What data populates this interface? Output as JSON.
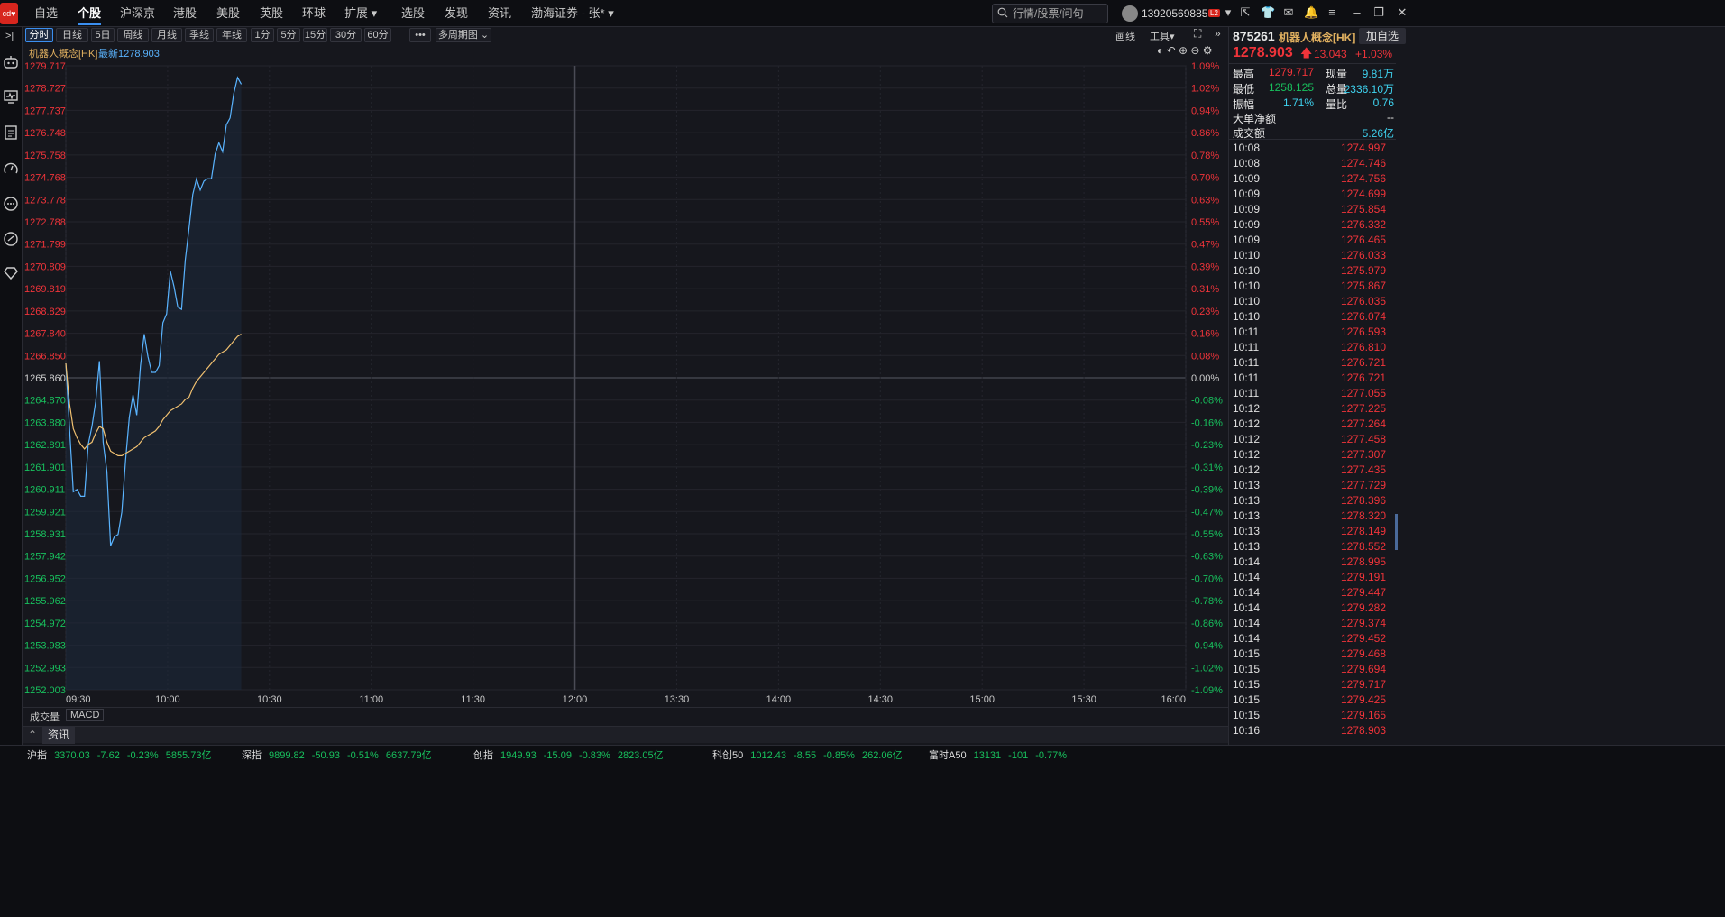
{
  "topnav": {
    "items": [
      "自选",
      "个股",
      "沪深京",
      "港股",
      "美股",
      "英股",
      "环球",
      "扩展 ▾",
      "选股",
      "发现",
      "资讯",
      "渤海证券 - 张* ▾"
    ],
    "active": 1,
    "logo": "cd♥",
    "search_placeholder": "行情/股票/问句",
    "user": "13920569885",
    "level_badge": "L2"
  },
  "left_icons": [
    "collapse-icon",
    "robot-icon",
    "monitor-icon",
    "notes-icon",
    "gauge-icon",
    "chat-icon",
    "link-icon",
    "diamond-icon"
  ],
  "toolbar": {
    "periods": [
      "分时",
      "日线",
      "5日",
      "周线",
      "月线",
      "季线",
      "年线",
      "1分",
      "5分",
      "15分",
      "30分",
      "60分",
      "•••",
      "多周期图 ⌄"
    ],
    "active": 0,
    "draw": "画线",
    "tools": "工具▾"
  },
  "chart_header": {
    "name": "机器人概念[HK]",
    "latest_label": "最新1278.903"
  },
  "chart_data": {
    "type": "line",
    "title": "机器人概念[HK]",
    "prev_close": 1265.86,
    "y_ticks": [
      "1279.717",
      "1278.727",
      "1277.737",
      "1276.748",
      "1275.758",
      "1274.768",
      "1273.778",
      "1272.788",
      "1271.799",
      "1270.809",
      "1269.819",
      "1268.829",
      "1267.840",
      "1266.850",
      "1265.860",
      "1264.870",
      "1263.880",
      "1262.891",
      "1261.901",
      "1260.911",
      "1259.921",
      "1258.931",
      "1257.942",
      "1256.952",
      "1255.962",
      "1254.972",
      "1253.983",
      "1252.993",
      "1252.003"
    ],
    "pct_ticks": [
      "1.09%",
      "1.02%",
      "0.94%",
      "0.86%",
      "0.78%",
      "0.70%",
      "0.63%",
      "0.55%",
      "0.47%",
      "0.39%",
      "0.31%",
      "0.23%",
      "0.16%",
      "0.08%",
      "0.00%",
      "-0.08%",
      "-0.16%",
      "-0.23%",
      "-0.31%",
      "-0.39%",
      "-0.47%",
      "-0.55%",
      "-0.63%",
      "-0.70%",
      "-0.78%",
      "-0.86%",
      "-0.94%",
      "-1.02%",
      "-1.09%"
    ],
    "x_ticks": [
      "09:30",
      "10:00",
      "10:30",
      "11:00",
      "11:30",
      "12:00",
      "13:30",
      "14:00",
      "14:30",
      "15:00",
      "15:30",
      "16:00"
    ],
    "ylim": [
      1252.003,
      1279.717
    ],
    "price": [
      1266.5,
      1263.6,
      1260.8,
      1260.9,
      1260.6,
      1260.6,
      1262.9,
      1263.7,
      1264.8,
      1266.6,
      1263.0,
      1261.7,
      1258.4,
      1258.8,
      1258.9,
      1259.9,
      1262.2,
      1264.1,
      1265.1,
      1264.2,
      1266.4,
      1267.8,
      1266.8,
      1266.1,
      1266.1,
      1266.4,
      1268.3,
      1268.7,
      1270.6,
      1269.9,
      1269.0,
      1268.9,
      1271.1,
      1272.5,
      1274.0,
      1274.7,
      1274.2,
      1274.6,
      1274.7,
      1274.7,
      1275.8,
      1276.3,
      1275.9,
      1277.1,
      1277.4,
      1278.5,
      1279.2,
      1278.9
    ],
    "avg": [
      1266.5,
      1264.7,
      1263.6,
      1263.2,
      1262.9,
      1262.7,
      1262.9,
      1263.0,
      1263.4,
      1263.7,
      1263.6,
      1263.0,
      1262.6,
      1262.5,
      1262.4,
      1262.4,
      1262.5,
      1262.6,
      1262.7,
      1262.8,
      1263.0,
      1263.2,
      1263.3,
      1263.4,
      1263.5,
      1263.7,
      1264.0,
      1264.2,
      1264.4,
      1264.5,
      1264.6,
      1264.7,
      1264.9,
      1265.0,
      1265.4,
      1265.7,
      1265.9,
      1266.1,
      1266.3,
      1266.5,
      1266.7,
      1266.9,
      1267.0,
      1267.1,
      1267.3,
      1267.5,
      1267.7,
      1267.8
    ]
  },
  "bottom_tabs": [
    "成交量",
    "MACD"
  ],
  "news_tab": "资讯",
  "quote": {
    "code": "875261",
    "name": "机器人概念[HK]",
    "add": "加自选",
    "price": "1278.903",
    "change": "13.043",
    "pct": "+1.03%",
    "stats": [
      {
        "l1": "最高",
        "v1": "1279.717",
        "c1": "red",
        "l2": "现量",
        "v2": "9.81万",
        "c2": "cyan"
      },
      {
        "l1": "最低",
        "v1": "1258.125",
        "c1": "green",
        "l2": "总量",
        "v2": "2336.10万",
        "c2": "cyan"
      },
      {
        "l1": "振幅",
        "v1": "1.71%",
        "c1": "cyan",
        "l2": "量比",
        "v2": "0.76",
        "c2": "cyan"
      }
    ],
    "big_order_label": "大单净额",
    "big_order": "--",
    "turnover_label": "成交额",
    "turnover": "5.26亿"
  },
  "ticks": [
    [
      "10:08",
      "1274.997"
    ],
    [
      "10:08",
      "1274.746"
    ],
    [
      "10:09",
      "1274.756"
    ],
    [
      "10:09",
      "1274.699"
    ],
    [
      "10:09",
      "1275.854"
    ],
    [
      "10:09",
      "1276.332"
    ],
    [
      "10:09",
      "1276.465"
    ],
    [
      "10:10",
      "1276.033"
    ],
    [
      "10:10",
      "1275.979"
    ],
    [
      "10:10",
      "1275.867"
    ],
    [
      "10:10",
      "1276.035"
    ],
    [
      "10:10",
      "1276.074"
    ],
    [
      "10:11",
      "1276.593"
    ],
    [
      "10:11",
      "1276.810"
    ],
    [
      "10:11",
      "1276.721"
    ],
    [
      "10:11",
      "1276.721"
    ],
    [
      "10:11",
      "1277.055"
    ],
    [
      "10:12",
      "1277.225"
    ],
    [
      "10:12",
      "1277.264"
    ],
    [
      "10:12",
      "1277.458"
    ],
    [
      "10:12",
      "1277.307"
    ],
    [
      "10:12",
      "1277.435"
    ],
    [
      "10:13",
      "1277.729"
    ],
    [
      "10:13",
      "1278.396"
    ],
    [
      "10:13",
      "1278.320"
    ],
    [
      "10:13",
      "1278.149"
    ],
    [
      "10:13",
      "1278.552"
    ],
    [
      "10:14",
      "1278.995"
    ],
    [
      "10:14",
      "1279.191"
    ],
    [
      "10:14",
      "1279.447"
    ],
    [
      "10:14",
      "1279.282"
    ],
    [
      "10:14",
      "1279.374"
    ],
    [
      "10:14",
      "1279.452"
    ],
    [
      "10:15",
      "1279.468"
    ],
    [
      "10:15",
      "1279.694"
    ],
    [
      "10:15",
      "1279.717"
    ],
    [
      "10:15",
      "1279.425"
    ],
    [
      "10:15",
      "1279.165"
    ],
    [
      "10:16",
      "1278.903"
    ]
  ],
  "ticker": [
    {
      "n": "沪指",
      "p": "3370.03",
      "c": "-7.62",
      "r": "-0.23%",
      "a": "5855.73亿"
    },
    {
      "n": "深指",
      "p": "9899.82",
      "c": "-50.93",
      "r": "-0.51%",
      "a": "6637.79亿"
    },
    {
      "n": "创指",
      "p": "1949.93",
      "c": "-15.09",
      "r": "-0.83%",
      "a": "2823.05亿"
    },
    {
      "n": "科创50",
      "p": "1012.43",
      "c": "-8.55",
      "r": "-0.85%",
      "a": "262.06亿"
    },
    {
      "n": "富时A50",
      "p": "13131",
      "c": "-101",
      "r": "-0.77%",
      "a": ""
    }
  ],
  "colors": {
    "up": "#f0343a",
    "down": "#18c05d",
    "line": "#5ab4ff",
    "avg": "#f0c070",
    "accent": "#3b8ff0"
  }
}
